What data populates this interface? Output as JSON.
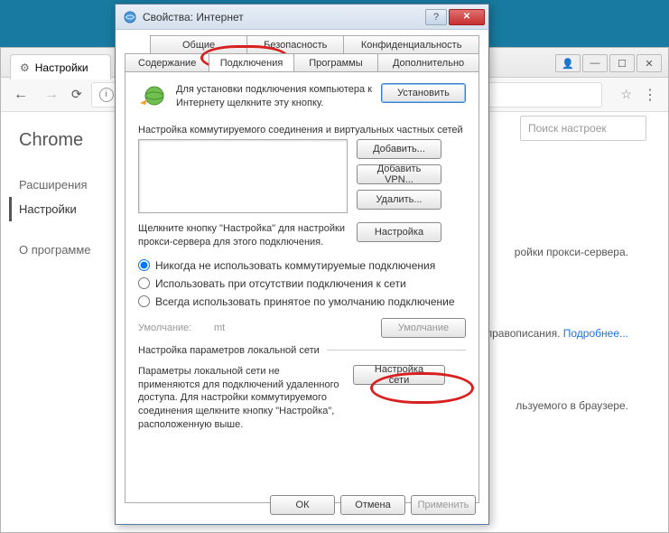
{
  "browser": {
    "tab_title": "Настройки",
    "user_icon": "user",
    "sidebar": {
      "title": "Chrome",
      "items": [
        "Расширения",
        "Настройки",
        "О программе"
      ],
      "search_placeholder": "Поиск настроек"
    },
    "body_text1": "ройки прокси-сервера.",
    "body_text2": "правописания.",
    "body_link": "Подробнее...",
    "body_text3": "льзуемого в браузере."
  },
  "dialog": {
    "title": "Свойства: Интернет",
    "tabs_row1": [
      "Общие",
      "Безопасность",
      "Конфиденциальность"
    ],
    "tabs_row2": [
      "Содержание",
      "Подключения",
      "Программы",
      "Дополнительно"
    ],
    "setup_text": "Для установки подключения компьютера к Интернету щелкните эту кнопку.",
    "btn_install": "Установить",
    "section_dialup": "Настройка коммутируемого соединения и виртуальных частных сетей",
    "btn_add": "Добавить...",
    "btn_add_vpn": "Добавить VPN...",
    "btn_remove": "Удалить...",
    "btn_settings": "Настройка",
    "proxy_text": "Щелкните кнопку \"Настройка\" для настройки прокси-сервера для этого подключения.",
    "radio1": "Никогда не использовать коммутируемые подключения",
    "radio2": "Использовать при отсутствии подключения к сети",
    "radio3": "Всегда использовать принятое по умолчанию подключение",
    "default_label": "Умолчание:",
    "default_value": "mt",
    "btn_default": "Умолчание",
    "section_lan": "Настройка параметров локальной сети",
    "lan_text": "Параметры локальной сети не применяются для подключений удаленного доступа. Для настройки коммутируемого соединения щелкните кнопку \"Настройка\", расположенную выше.",
    "btn_lan": "Настройка сети",
    "btn_ok": "ОК",
    "btn_cancel": "Отмена",
    "btn_apply": "Применить"
  }
}
